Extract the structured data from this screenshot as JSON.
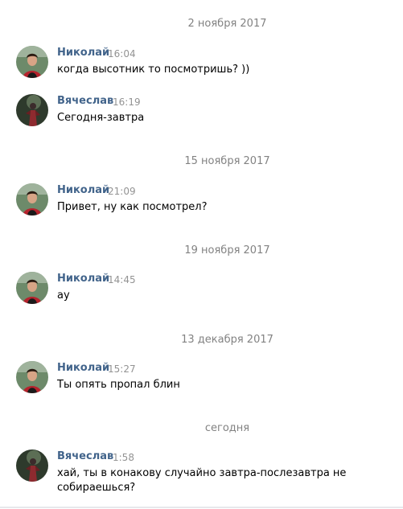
{
  "colors": {
    "author": "#42648b",
    "time": "#939393",
    "date_separator": "#828282",
    "text": "#000000"
  },
  "date_separators": [
    "2 ноября 2017",
    "15 ноября 2017",
    "19 ноября 2017",
    "13 декабря 2017",
    "сегодня"
  ],
  "messages": [
    {
      "author": "Николай",
      "time": "16:04",
      "text": "когда высотник то посмотришь? ))",
      "avatar": "nikolai-avatar"
    },
    {
      "author": "Вячеслав",
      "time": "16:19",
      "text": "Сегодня-завтра",
      "avatar": "vyacheslav-avatar"
    },
    {
      "author": "Николай",
      "time": "21:09",
      "text": "Привет, ну как посмотрел?",
      "avatar": "nikolai-avatar"
    },
    {
      "author": "Николай",
      "time": "14:45",
      "text": "ау",
      "avatar": "nikolai-avatar"
    },
    {
      "author": "Николай",
      "time": "15:27",
      "text": "Ты опять пропал блин",
      "avatar": "nikolai-avatar"
    },
    {
      "author": "Вячеслав",
      "time": "1:58",
      "text": "хай, ты в конакову случайно завтра-послезавтра не собираешься?",
      "avatar": "vyacheslav-avatar"
    }
  ]
}
